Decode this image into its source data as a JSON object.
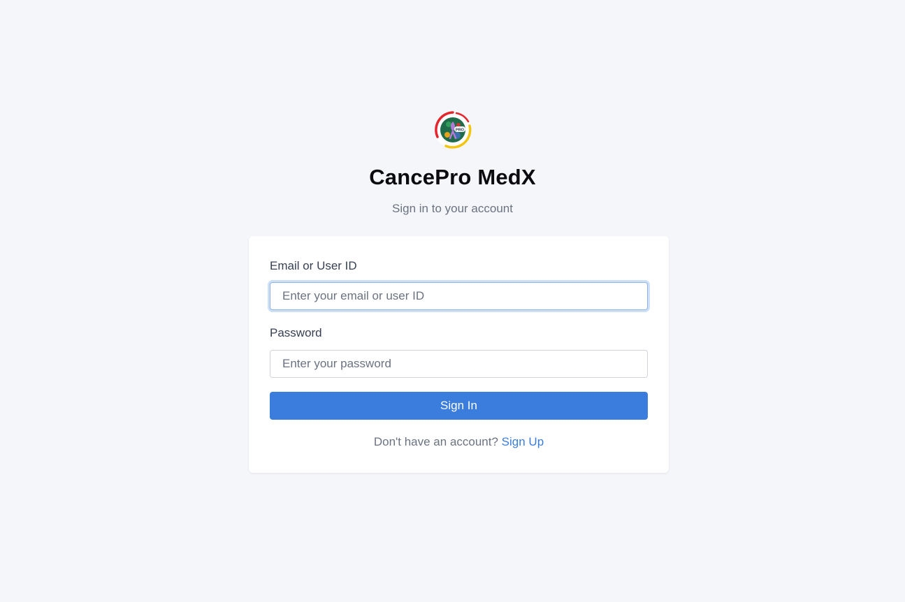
{
  "app": {
    "title": "CancePro MedX",
    "subtitle": "Sign in to your account",
    "logo_icon": "cancepro-logo-icon"
  },
  "form": {
    "email_label": "Email or User ID",
    "email_placeholder": "Enter your email or user ID",
    "email_value": "",
    "password_label": "Password",
    "password_placeholder": "Enter your password",
    "password_value": "",
    "submit_label": "Sign In"
  },
  "signup": {
    "prompt": "Don't have an account?",
    "link_label": "Sign Up"
  },
  "colors": {
    "background": "#f5f6fa",
    "accent": "#3b7ddd",
    "card": "#ffffff"
  }
}
